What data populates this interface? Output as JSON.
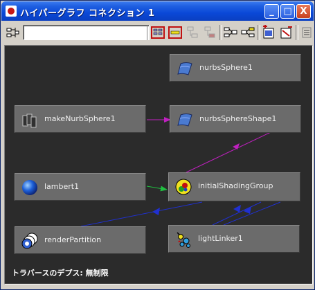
{
  "window": {
    "title": "ハイパーグラフ コネクション 1"
  },
  "titlebar_buttons": {
    "minimize": "_",
    "maximize": "□",
    "close": "X"
  },
  "toolbar": {
    "search_value": "",
    "icons": [
      "graph-nav-icon",
      "frame-all-icon",
      "frame-selection-icon",
      "graph-up-icon",
      "graph-down-icon",
      "input-connections-icon",
      "output-connections-icon",
      "add-selected-icon",
      "remove-selected-icon",
      "clear-graph-icon"
    ]
  },
  "nodes": {
    "nurbsSphere1": "nurbsSphere1",
    "makeNurbSphere1": "makeNurbSphere1",
    "nurbsSphereShape1": "nurbsSphereShape1",
    "lambert1": "lambert1",
    "initialShadingGroup": "initialShadingGroup",
    "renderPartition": "renderPartition",
    "lightLinker1": "lightLinker1"
  },
  "status": {
    "traversal_depth": "トラバースのデプス: 無制限"
  },
  "colors": {
    "wire_magenta": "#c020c0",
    "wire_green": "#20c040",
    "wire_blue": "#2030d0",
    "graph_bg": "#2b2b2b",
    "node_bg": "#6b6b6b"
  }
}
